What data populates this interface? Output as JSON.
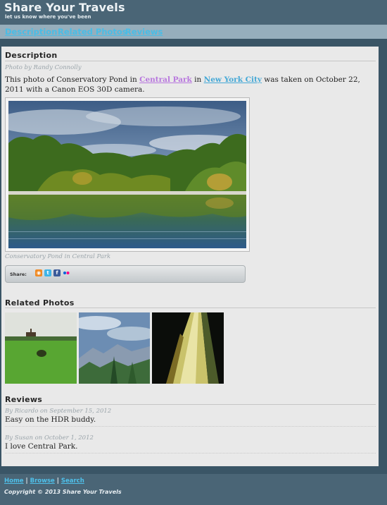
{
  "site": {
    "title": "Share Your Travels",
    "tagline": "let us know where you've been"
  },
  "nav": {
    "description": "Description",
    "related": "Related Photos",
    "reviews": "Reviews"
  },
  "description": {
    "heading": "Description",
    "byline": "Photo by Randy Connolly",
    "text_before": "This photo of Conservatory Pond in ",
    "link_park": "Central Park",
    "text_in": " in ",
    "link_city": "New York City",
    "text_after": " was taken on October 22, 2011 with a Canon EOS 30D camera.",
    "caption": "Conservatory Pond in Central Park"
  },
  "share": {
    "label": "Share:",
    "icons": [
      "rss-icon",
      "twitter-icon",
      "facebook-icon",
      "flickr-icon"
    ]
  },
  "related": {
    "heading": "Related Photos"
  },
  "reviews": {
    "heading": "Reviews",
    "items": [
      {
        "meta": "By Ricardo on September 15, 2012",
        "text": "Easy on the HDR buddy."
      },
      {
        "meta": "By Susan on October 1, 2012",
        "text": "I love Central Park."
      }
    ]
  },
  "footer": {
    "home": "Home",
    "browse": "Browse",
    "search": "Search",
    "separator": "|",
    "copyright": "Copyright © 2013 Share Your Travels"
  },
  "colors": {
    "header_bg": "#4a6576",
    "nav_bg": "#96aebc",
    "link": "#49bde6",
    "visited_link": "#b877de",
    "panel_bg": "#e9e9e9"
  }
}
